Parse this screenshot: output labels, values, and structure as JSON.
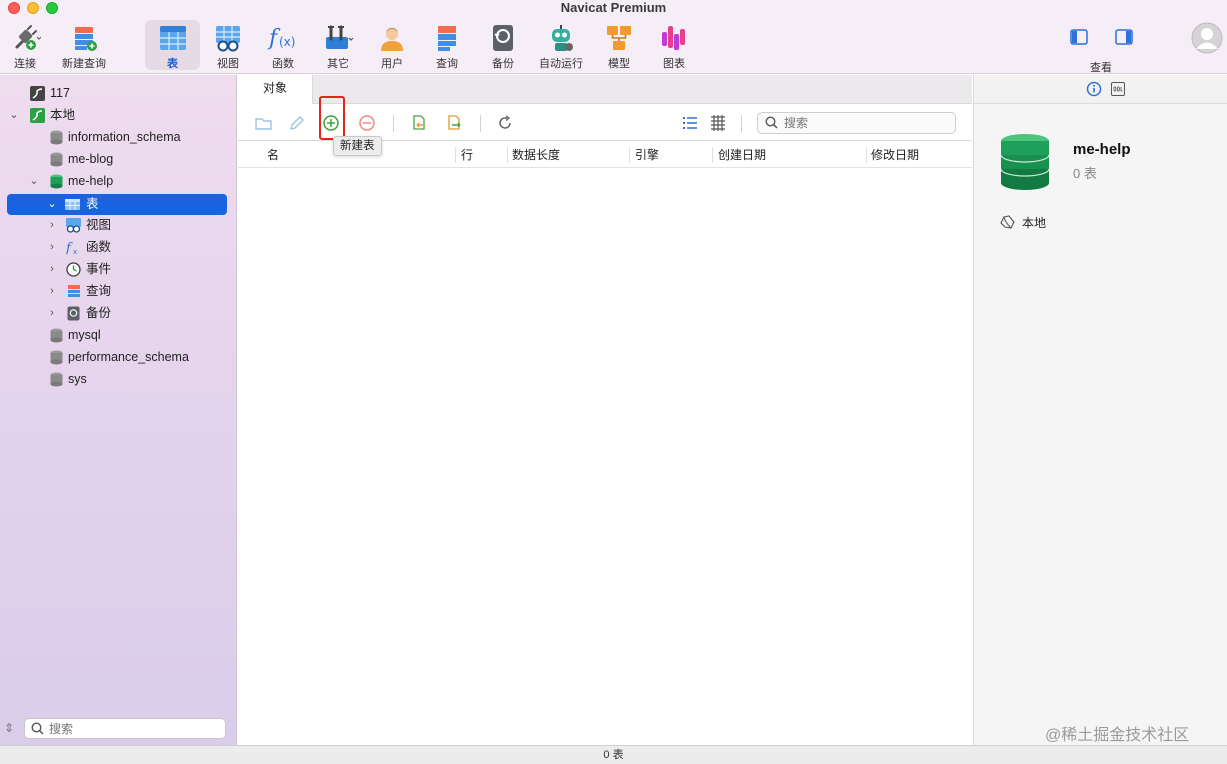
{
  "window": {
    "title": "Navicat Premium"
  },
  "toolbar": {
    "items": [
      {
        "label": "连接",
        "icon": "plug-icon"
      },
      {
        "label": "新建查询",
        "icon": "new-query-icon"
      },
      {
        "label": "表",
        "icon": "table-icon",
        "active": true
      },
      {
        "label": "视图",
        "icon": "view-icon"
      },
      {
        "label": "函数",
        "icon": "function-icon"
      },
      {
        "label": "其它",
        "icon": "tools-icon"
      },
      {
        "label": "用户",
        "icon": "user-icon"
      },
      {
        "label": "查询",
        "icon": "query-icon"
      },
      {
        "label": "备份",
        "icon": "backup-icon"
      },
      {
        "label": "自动运行",
        "icon": "robot-icon"
      },
      {
        "label": "模型",
        "icon": "model-icon"
      },
      {
        "label": "图表",
        "icon": "chart-icon"
      }
    ],
    "view_label": "查看"
  },
  "sidebar": {
    "tree": [
      {
        "label": "117"
      },
      {
        "label": "本地"
      },
      {
        "label": "information_schema"
      },
      {
        "label": "me-blog"
      },
      {
        "label": "me-help"
      },
      {
        "label": "表"
      },
      {
        "label": "视图"
      },
      {
        "label": "函数"
      },
      {
        "label": "事件"
      },
      {
        "label": "查询"
      },
      {
        "label": "备份"
      },
      {
        "label": "mysql"
      },
      {
        "label": "performance_schema"
      },
      {
        "label": "sys"
      }
    ],
    "search_placeholder": "搜索"
  },
  "main": {
    "tab_label": "对象",
    "search_placeholder": "搜索",
    "tooltip": "新建表",
    "columns": [
      "名",
      "行",
      "数据长度",
      "引擎",
      "创建日期",
      "修改日期"
    ]
  },
  "info": {
    "name": "me-help",
    "count": "0 表",
    "connection": "本地"
  },
  "status": {
    "text": "0 表"
  },
  "watermark": "@稀土掘金技术社区",
  "colors": {
    "accent": "#1763e0",
    "db_green": "#1fa05a",
    "highlight": "#e0261d",
    "add_green": "#3aa53a",
    "delete_red": "#f08a86"
  }
}
